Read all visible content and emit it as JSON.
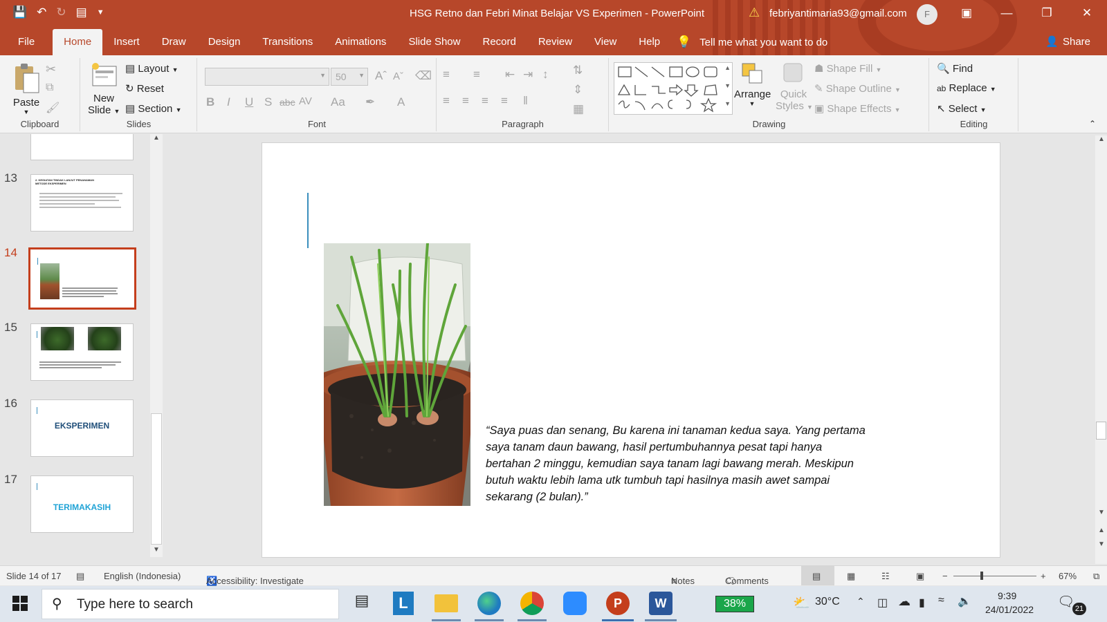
{
  "app": {
    "title": "HSG Retno dan Febri Minat Belajar VS Experimen  -  PowerPoint",
    "account": "febriyantimaria93@gmail.com",
    "avatar_letter": "F"
  },
  "menu": {
    "tabs": [
      "File",
      "Home",
      "Insert",
      "Draw",
      "Design",
      "Transitions",
      "Animations",
      "Slide Show",
      "Record",
      "Review",
      "View",
      "Help"
    ],
    "active": "Home",
    "tell_me": "Tell me what you want to do",
    "share": "Share"
  },
  "ribbon": {
    "clipboard": {
      "paste": "Paste",
      "label": "Clipboard"
    },
    "slides": {
      "new_slide_1": "New",
      "new_slide_2": "Slide",
      "layout": "Layout",
      "reset": "Reset",
      "section": "Section",
      "label": "Slides"
    },
    "font": {
      "size": "50",
      "bold": "B",
      "italic": "I",
      "underline": "U",
      "shadow": "S",
      "strike": "abc",
      "spacing": "AV",
      "case": "Aa",
      "color": "A",
      "label": "Font"
    },
    "paragraph": {
      "label": "Paragraph"
    },
    "drawing": {
      "arrange": "Arrange",
      "quick_styles_1": "Quick",
      "quick_styles_2": "Styles",
      "shape_fill": "Shape Fill",
      "shape_outline": "Shape Outline",
      "shape_effects": "Shape Effects",
      "label": "Drawing"
    },
    "editing": {
      "find": "Find",
      "replace": "Replace",
      "select": "Select",
      "label": "Editing"
    }
  },
  "thumbnails": [
    {
      "num": "13",
      "title": "2. KEGIATAN TINDAK LANJUT PENANAMAN METODE EKSPERIMEN"
    },
    {
      "num": "14",
      "selected": true
    },
    {
      "num": "15"
    },
    {
      "num": "16",
      "title": "EKSPERIMEN"
    },
    {
      "num": "17",
      "title": "TERIMAKASIH"
    }
  ],
  "slide": {
    "quote_lines": [
      "“Saya puas dan senang, Bu karena ini tanaman kedua saya. Yang pertama",
      "saya tanam daun bawang, hasil pertumbuhannya pesat tapi hanya",
      "bertahan 2 minggu, kemudian saya tanam lagi bawang merah. Meskipun",
      "butuh waktu lebih lama utk tumbuh tapi hasilnya masih awet sampai",
      "sekarang (2 bulan).”"
    ]
  },
  "status": {
    "slide_info": "Slide 14 of 17",
    "language": "English (Indonesia)",
    "accessibility": "Accessibility: Investigate",
    "notes": "Notes",
    "comments": "Comments",
    "zoom": "67%"
  },
  "taskbar": {
    "search_placeholder": "Type here to search",
    "battery": "38%",
    "temperature": "30°C",
    "time": "9:39",
    "date": "24/01/2022",
    "notifications": "21"
  },
  "colors": {
    "accent": "#b7472a",
    "selected_thumb": "#c43e1c",
    "title_blue": "#1f4e79",
    "title_cyan": "#1fa3d6"
  }
}
